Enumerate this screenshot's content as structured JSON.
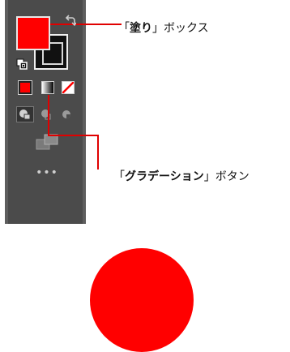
{
  "callouts": {
    "fill": {
      "open": "「",
      "bold": "塗り",
      "close": "」",
      "suffix": "ボックス"
    },
    "gradient": {
      "open": "「",
      "bold": "グラデーション",
      "close": "」",
      "suffix": "ボタン"
    }
  },
  "toolbar": {
    "fill_color": "#ff0000",
    "stroke_color": "#111111",
    "more_label": "•••"
  },
  "icons": {
    "swap": "swap-arrow-icon",
    "default": "default-fill-stroke-icon",
    "screen_mode": "screen-mode-icon"
  },
  "colors": {
    "accent": "#e00000",
    "toolbar_bg": "#4b4b4b",
    "sample_shape": "#ff0000"
  }
}
